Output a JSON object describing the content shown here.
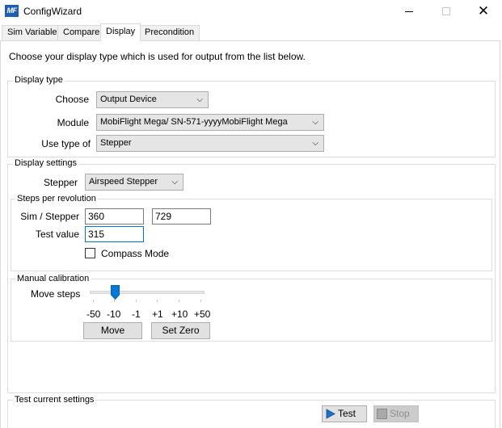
{
  "window": {
    "title": "ConfigWizard",
    "icon": "mobiflight-logo-icon",
    "icon_text": "MF"
  },
  "tabs": [
    {
      "label": "Sim Variable",
      "active": false
    },
    {
      "label": "Compare",
      "active": false
    },
    {
      "label": "Display",
      "active": true
    },
    {
      "label": "Precondition",
      "active": false
    }
  ],
  "intro": "Choose your display type which is used for output from the list below.",
  "display_type": {
    "legend": "Display type",
    "choose_label": "Choose",
    "choose_value": "Output Device",
    "module_label": "Module",
    "module_value": "MobiFlight Mega/ SN-571-yyyyMobiFlight Mega",
    "use_type_label": "Use type of",
    "use_type_value": "Stepper"
  },
  "display_settings": {
    "legend": "Display settings",
    "stepper_label": "Stepper",
    "stepper_value": "Airspeed Stepper",
    "steps_per_revolution": {
      "legend": "Steps per revolution",
      "sim_stepper_label": "Sim / Stepper",
      "sim_value": "360",
      "stepper_value": "729",
      "test_value_label": "Test value",
      "test_value": "315",
      "compass_label": "Compass Mode",
      "compass_checked": false
    },
    "manual_calibration": {
      "legend": "Manual calibration",
      "move_steps_label": "Move steps",
      "slider_labels": [
        "-50",
        "-10",
        "-1",
        "+1",
        "+10",
        "+50"
      ],
      "slider_position": "-10",
      "move_button": "Move",
      "set_zero_button": "Set Zero"
    }
  },
  "test_settings": {
    "legend": "Test current settings",
    "test_button": "Test",
    "stop_button": "Stop",
    "stop_disabled": true
  },
  "colors": {
    "accent": "#0078d7",
    "border": "#dcdcdc",
    "button": "#e1e1e1"
  }
}
